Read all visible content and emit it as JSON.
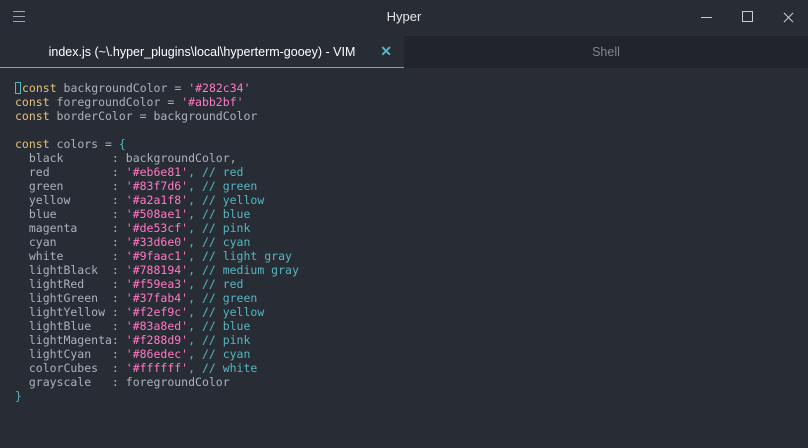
{
  "window": {
    "title": "Hyper"
  },
  "tabs": [
    {
      "label": "index.js (~\\.hyper_plugins\\local\\hyperterm-gooey) - VIM",
      "active": true,
      "close_glyph": "✕"
    },
    {
      "label": "Shell",
      "active": false
    }
  ],
  "icons": {
    "menu": "hamburger-icon",
    "minimize": "minimize-icon",
    "maximize": "maximize-icon",
    "close": "close-icon"
  },
  "code": {
    "decls": [
      {
        "kw": "const",
        "text": " backgroundColor = ",
        "str": "'#282c34'"
      },
      {
        "kw": "const",
        "text": " foregroundColor = ",
        "str": "'#abb2bf'"
      },
      {
        "kw": "const",
        "text": " borderColor = backgroundColor"
      }
    ],
    "colors_open": {
      "kw": "const",
      "text": " colors = ",
      "brace": "{"
    },
    "colors": [
      {
        "key": "  black       : ",
        "val": "backgroundColor,"
      },
      {
        "key": "  red         : ",
        "str": "'#eb6e81'",
        "comment": ", // red"
      },
      {
        "key": "  green       : ",
        "str": "'#83f7d6'",
        "comment": ", // green"
      },
      {
        "key": "  yellow      : ",
        "str": "'#a2a1f8'",
        "comment": ", // yellow"
      },
      {
        "key": "  blue        : ",
        "str": "'#508ae1'",
        "comment": ", // blue"
      },
      {
        "key": "  magenta     : ",
        "str": "'#de53cf'",
        "comment": ", // pink"
      },
      {
        "key": "  cyan        : ",
        "str": "'#33d6e0'",
        "comment": ", // cyan"
      },
      {
        "key": "  white       : ",
        "str": "'#9faac1'",
        "comment": ", // light gray"
      },
      {
        "key": "  lightBlack  : ",
        "str": "'#788194'",
        "comment": ", // medium gray"
      },
      {
        "key": "  lightRed    : ",
        "str": "'#f59ea3'",
        "comment": ", // red"
      },
      {
        "key": "  lightGreen  : ",
        "str": "'#37fab4'",
        "comment": ", // green"
      },
      {
        "key": "  lightYellow : ",
        "str": "'#f2ef9c'",
        "comment": ", // yellow"
      },
      {
        "key": "  lightBlue   : ",
        "str": "'#83a8ed'",
        "comment": ", // blue"
      },
      {
        "key": "  lightMagenta: ",
        "str": "'#f288d9'",
        "comment": ", // pink"
      },
      {
        "key": "  lightCyan   : ",
        "str": "'#86edec'",
        "comment": ", // cyan"
      },
      {
        "key": "  colorCubes  : ",
        "str": "'#ffffff'",
        "comment": ", // white"
      },
      {
        "key": "  grayscale   : ",
        "val": "foregroundColor"
      }
    ],
    "colors_close": "}"
  }
}
